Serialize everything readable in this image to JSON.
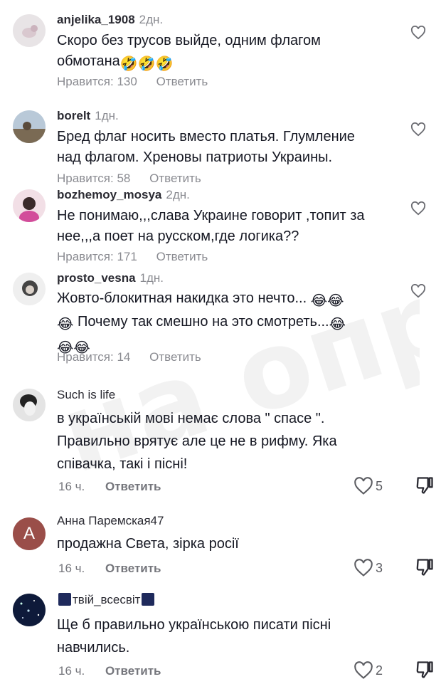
{
  "comments": [
    {
      "username": "anjelika_1908",
      "time": "2дн.",
      "lines": [
        "Скоро без трусов выйде, одним флагом",
        "обмотана"
      ],
      "likes_label": "Нравится: 130",
      "reply": "Ответить"
    },
    {
      "username": "borelt",
      "time": "1дн.",
      "lines": [
        "Бред флаг носить вместо платья. Глумление",
        "над флагом. Хреновы патриоты Украины."
      ],
      "likes_label": "Нравится: 58",
      "reply": "Ответить"
    },
    {
      "username": "bozhemoy_mosya",
      "time": "2дн.",
      "lines": [
        "Не понимаю,,,слава Украине говорит ,топит за",
        "нее,,,а поет на русском,где логика??"
      ],
      "likes_label": "Нравится: 171",
      "reply": "Ответить"
    },
    {
      "username": "prosto_vesna",
      "time": "1дн.",
      "lines": [
        "Жовто-блокитная накидка это нечто...",
        "Почему так смешно на это смотреть...",
        ""
      ],
      "likes_label": "Нравится: 14",
      "reply": "Ответить"
    },
    {
      "username": "Such is life",
      "time": "16 ч.",
      "lines": [
        "в українській мові немає слова \" спасе \".",
        "Правильно врятує але це не в рифму. Яка",
        "співачка, такі і пісні!"
      ],
      "like_count": "5",
      "reply": "Ответить"
    },
    {
      "username": "Анна Паремская47",
      "avatar_letter": "A",
      "time": "16 ч.",
      "lines": [
        "продажна Света, зірка росії"
      ],
      "like_count": "3",
      "reply": "Ответить"
    },
    {
      "username": "твій_всесвіт",
      "time": "16 ч.",
      "lines": [
        "Ще б правильно українською писати пісні",
        "навчились."
      ],
      "like_count": "2",
      "reply": "Ответить"
    }
  ],
  "watermark": "на опра,",
  "colors": {
    "text": "#161823",
    "meta": "#8a8b91",
    "avatar_a": "#9a4e49"
  }
}
